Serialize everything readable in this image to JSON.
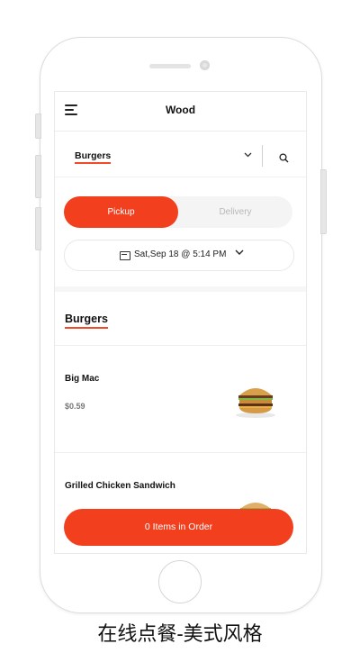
{
  "header": {
    "title": "Wood",
    "menu_icon": "hamburger-menu-icon"
  },
  "category_bar": {
    "selected": "Burgers",
    "chevron": "⌄",
    "search_icon": "search-icon"
  },
  "service_toggle": {
    "pickup_label": "Pickup",
    "delivery_label": "Delivery",
    "active": "Pickup"
  },
  "schedule": {
    "datetime": "Sat,Sep 18 @ 5:14 PM",
    "calendar_icon": "calendar-icon"
  },
  "menu": {
    "section_title": "Burgers",
    "items": [
      {
        "name": "Big Mac",
        "price": "$0.59",
        "image": "burger-image"
      },
      {
        "name": "Grilled Chicken Sandwich",
        "price": "",
        "image": "sandwich-image"
      }
    ]
  },
  "order_button": {
    "label": "0 Items in Order"
  },
  "caption": "在线点餐-美式风格",
  "colors": {
    "accent": "#f2401f",
    "text": "#111111",
    "muted": "#b8b8b8"
  }
}
